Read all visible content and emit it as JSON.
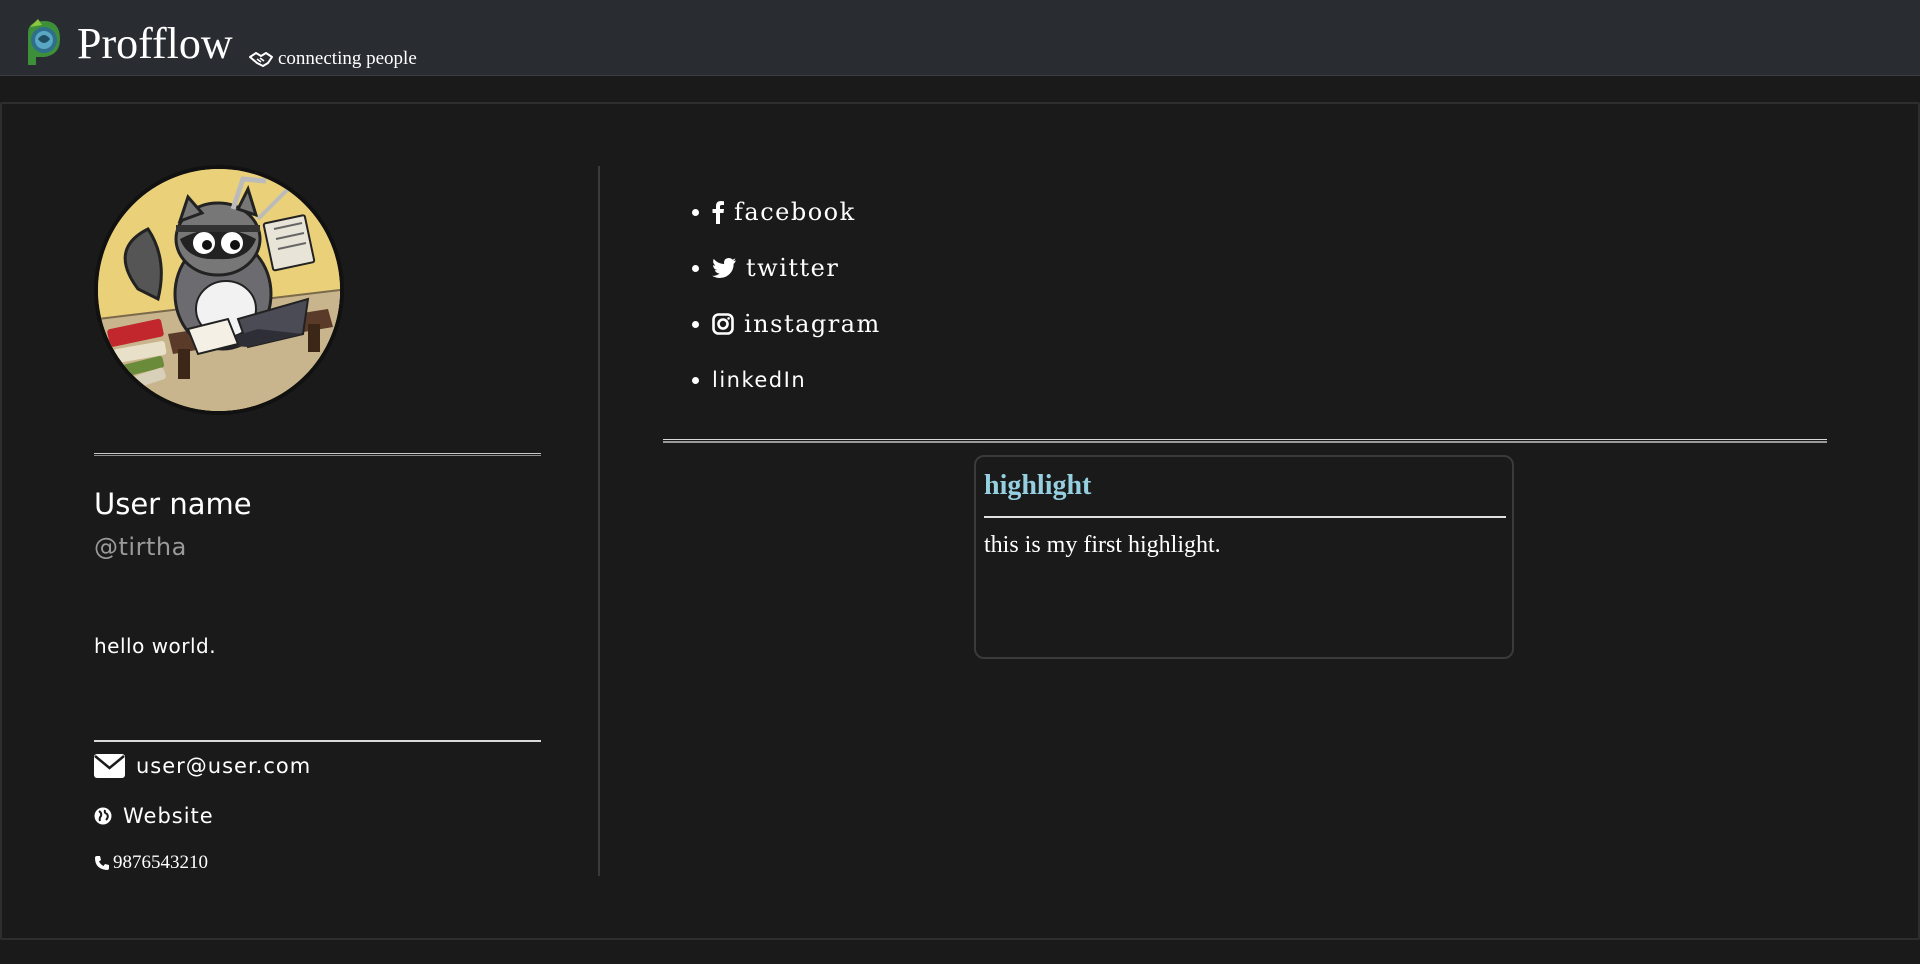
{
  "header": {
    "brand": "Profflow",
    "tagline": "connecting people",
    "logo_icon": "profflow-logo-icon",
    "tagline_icon": "handshake-icon"
  },
  "profile": {
    "avatar_icon": "raccoon-avatar-image",
    "user_name": "User name",
    "handle": "@tirtha",
    "bio": "hello world.",
    "contact": {
      "email": "user@user.com",
      "website": "Website",
      "phone": "9876543210"
    }
  },
  "social": {
    "items": [
      {
        "label": "facebook",
        "icon": "facebook-icon"
      },
      {
        "label": "twitter",
        "icon": "twitter-icon"
      },
      {
        "label": "instagram",
        "icon": "instagram-icon"
      },
      {
        "label": "linkedIn",
        "icon": ""
      }
    ]
  },
  "highlight": {
    "title": "highlight",
    "body": "this is my first highlight."
  },
  "colors": {
    "background": "#1b1a1b",
    "navbar": "#292d32",
    "highlight_title": "#95cfe0",
    "handle_text": "#9a9a9a"
  }
}
